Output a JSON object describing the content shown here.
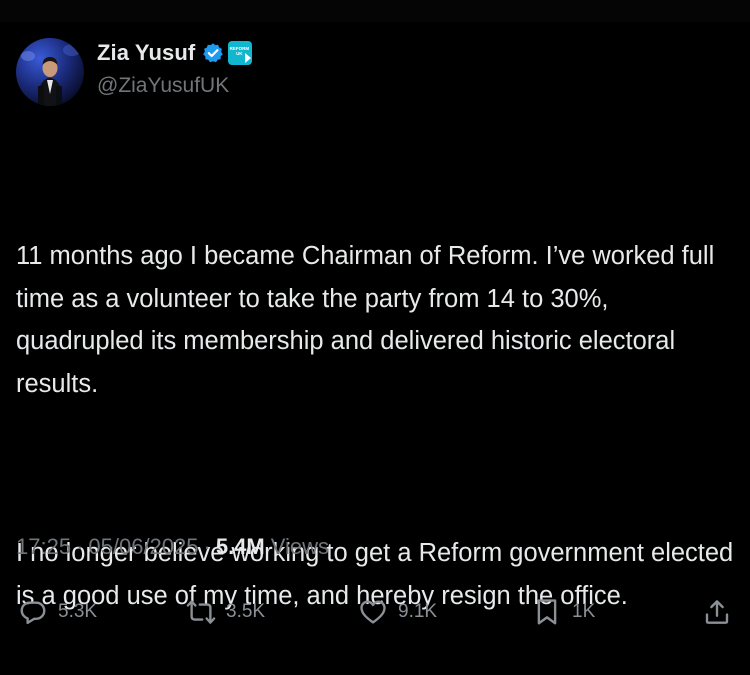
{
  "status_bar": {},
  "author": {
    "display_name": "Zia Yusuf",
    "handle": "@ZiaYusufUK",
    "affiliate_badge_text": "REFORM UK",
    "verified": true
  },
  "tweet": {
    "paragraphs": [
      "11 months ago I became Chairman of Reform. I’ve worked full time as a volunteer to take the party from 14 to 30%, quadrupled its membership and delivered historic electoral results.",
      "I no longer believe working to get a Reform government elected is a good use of my time, and hereby resign the office."
    ]
  },
  "meta": {
    "time": "17:25",
    "separator": "·",
    "date": "05/06/2025",
    "views_count": "5.4M",
    "views_label": "Views"
  },
  "actions": {
    "replies": "5.3K",
    "reposts": "3.5K",
    "likes": "9.1K",
    "bookmarks": "1K"
  },
  "colors": {
    "background": "#000000",
    "text": "#e7e9ea",
    "secondary": "#71767b",
    "verified_blue": "#1d9bf0",
    "affiliate_teal": "#12b6cf"
  },
  "icons": {
    "reply": "reply-icon",
    "repost": "repost-icon",
    "like": "heart-icon",
    "bookmark": "bookmark-icon",
    "share": "share-icon",
    "verified": "verified-badge-icon"
  }
}
